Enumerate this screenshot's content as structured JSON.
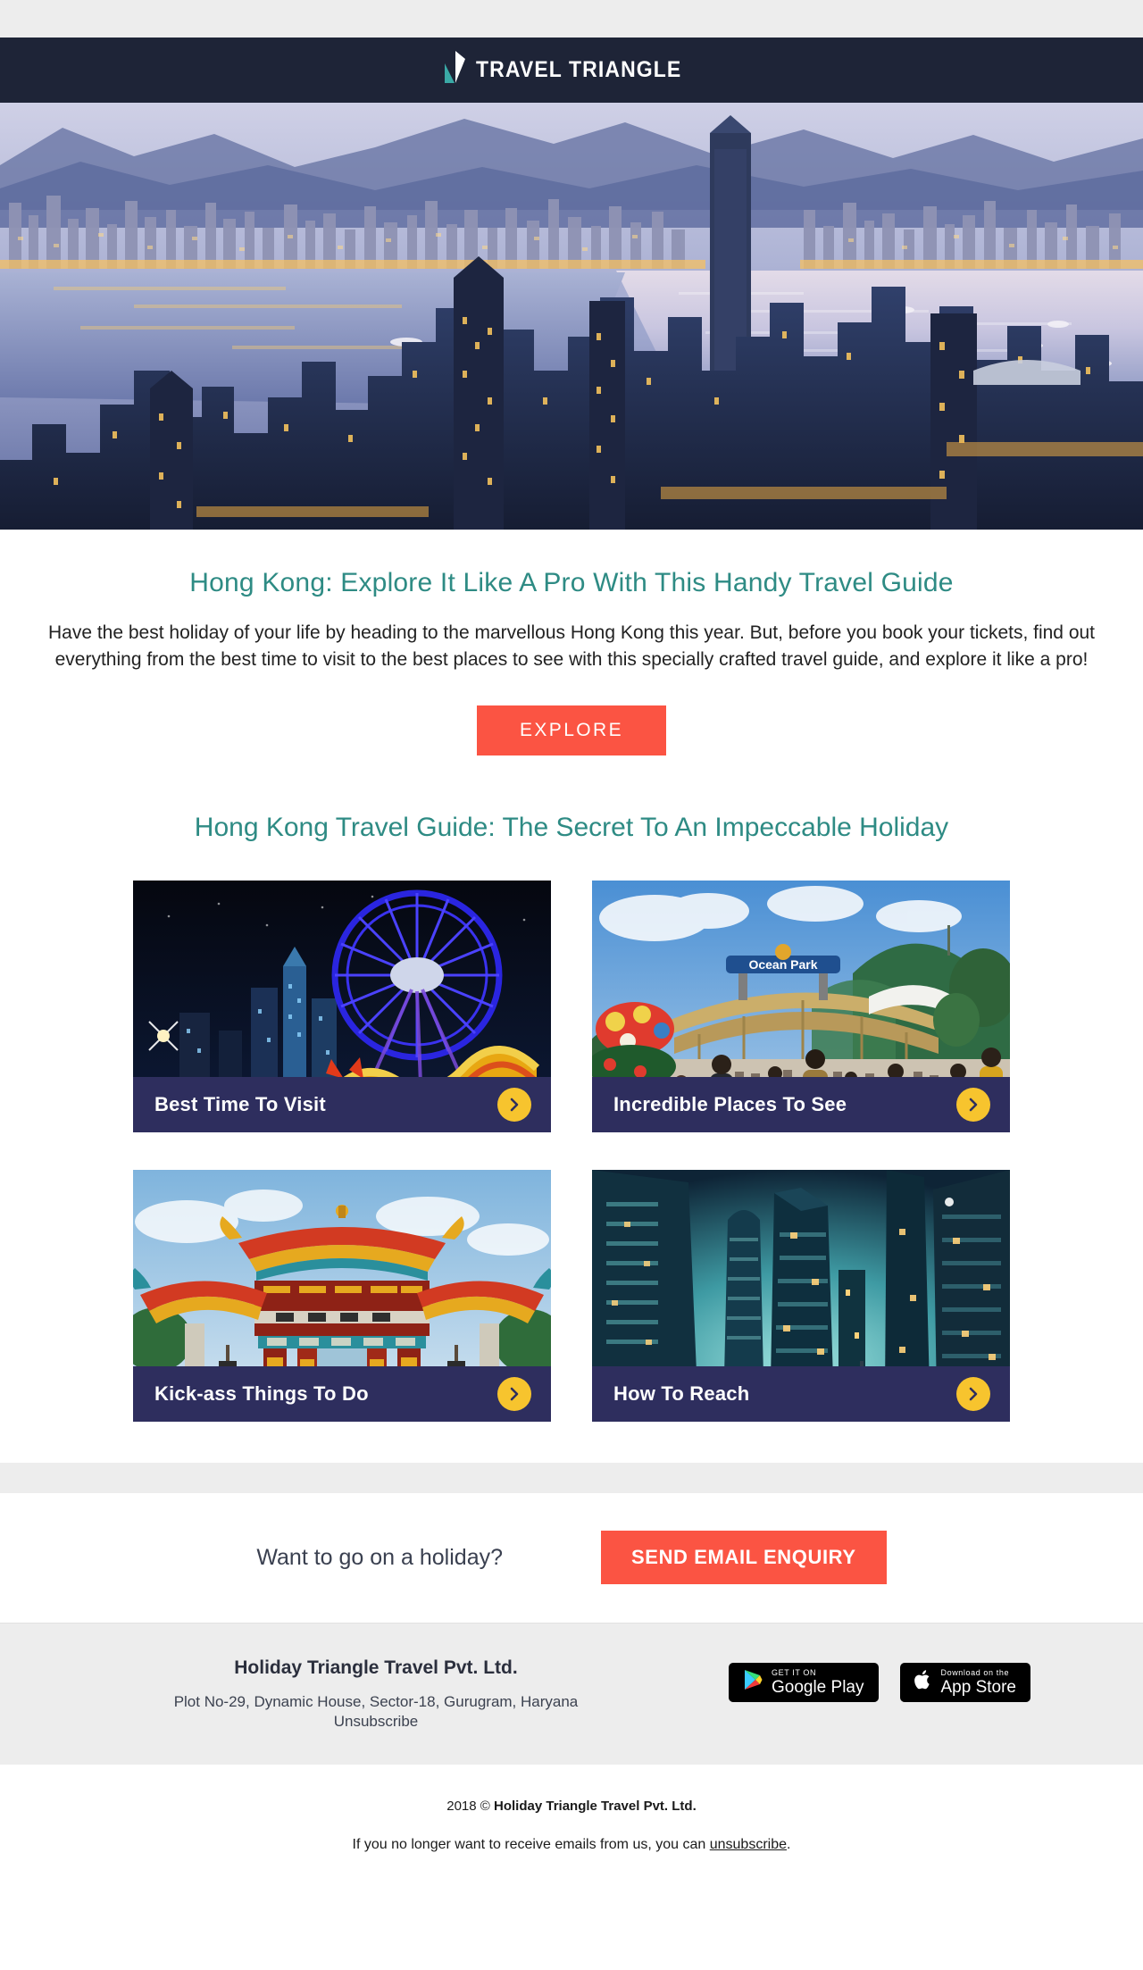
{
  "brand": {
    "logo_text": "TRAVEL TRIANGLE",
    "logo_icon": "triangle-sail-logo",
    "header_bg": "#1e2437",
    "accent_teal": "#2e8b84",
    "accent_coral": "#fb5443",
    "accent_yellow": "#f7c42e",
    "card_bar_navy": "#2e2e5e"
  },
  "hero": {
    "alt": "Hong Kong Victoria Harbour skyline at dusk"
  },
  "intro": {
    "title": "Hong Kong: Explore It Like A Pro With This Handy Travel Guide",
    "body": "Have the best holiday of your life by heading to the marvellous Hong Kong this year. But, before you book your tickets, find out everything from the best time to visit to the best places to see with this specially crafted travel guide, and explore it like a pro!",
    "cta_label": "EXPLORE"
  },
  "guide": {
    "heading": "Hong Kong Travel Guide: The Secret To An Impeccable Holiday",
    "cards": [
      {
        "label": "Best Time To Visit",
        "image": "hk-night-ferris-wheel-dragon-lantern",
        "arrow_icon": "chevron-right-icon"
      },
      {
        "label": "Incredible Places To See",
        "image": "ocean-park-entrance-crowd",
        "arrow_icon": "chevron-right-icon"
      },
      {
        "label": "Kick-ass Things To Do",
        "image": "chinese-temple-gate",
        "arrow_icon": "chevron-right-icon"
      },
      {
        "label": "How To Reach",
        "image": "hk-cbd-towers-night-light-trails",
        "arrow_icon": "chevron-right-icon"
      }
    ]
  },
  "enquiry": {
    "question": "Want to go on a holiday?",
    "button_label": "SEND EMAIL ENQUIRY"
  },
  "footer": {
    "company": "Holiday Triangle Travel Pvt. Ltd.",
    "address": "Plot No-29, Dynamic House, Sector-18, Gurugram, Haryana",
    "unsubscribe_label": "Unsubscribe",
    "badges": [
      {
        "small": "GET IT ON",
        "big": "Google Play",
        "icon": "google-play-icon"
      },
      {
        "small": "Download on the",
        "big": "App Store",
        "icon": "apple-icon"
      }
    ]
  },
  "copyright": {
    "year_mark": "2018 © ",
    "company": "Holiday Triangle Travel Pvt. Ltd.",
    "notice_prefix": "If you no longer want to receive emails from us, you can ",
    "notice_link": "unsubscribe",
    "notice_suffix": "."
  }
}
